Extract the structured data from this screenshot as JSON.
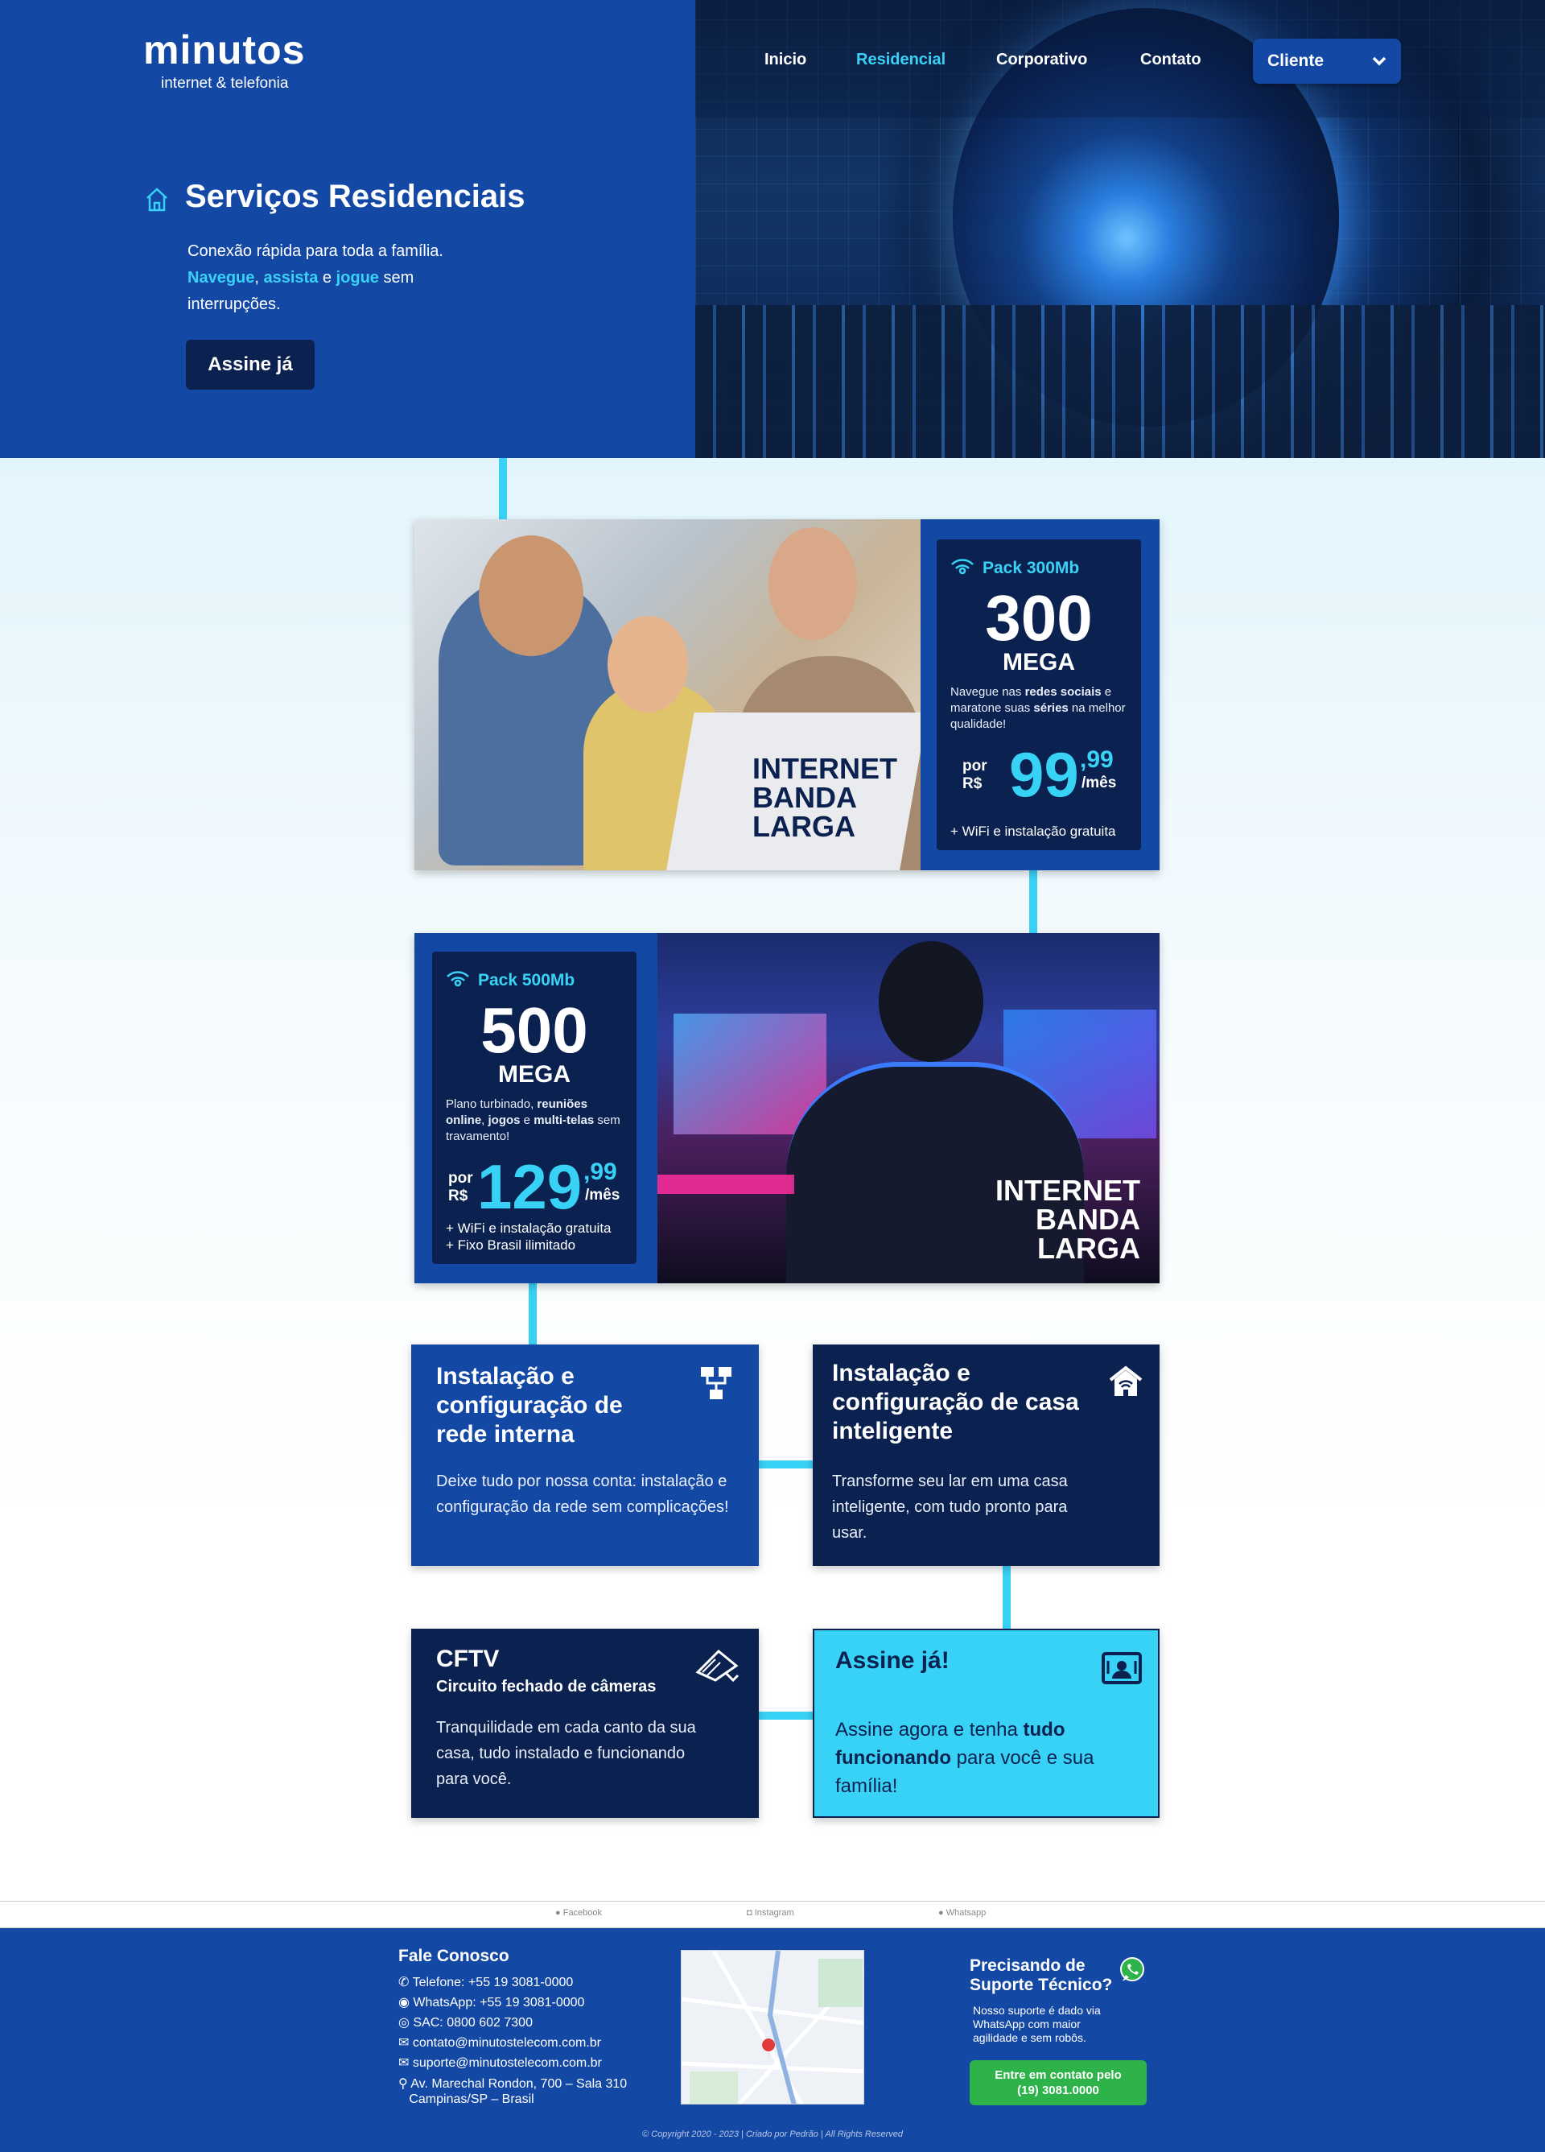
{
  "brand": {
    "name": "minutos",
    "tagline": "internet & telefonia"
  },
  "nav": {
    "items": [
      "Inicio",
      "Residencial",
      "Corporativo",
      "Contato"
    ],
    "active": "Residencial",
    "dropdown_label": "Cliente"
  },
  "hero": {
    "title": "Serviços Residenciais",
    "line1": "Conexão rápida para toda a família.",
    "w_navegue": "Navegue",
    "comma": ",",
    "w_assista": "assista",
    "and": " e ",
    "w_jogue": "jogue",
    "sem": " sem",
    "line3": "interrupções.",
    "cta": "Assine já"
  },
  "packs": [
    {
      "name": "Pack 300Mb",
      "speed": "300",
      "unit": "MEGA",
      "desc_a": "Navegue nas ",
      "desc_b": "redes sociais",
      "desc_c": " e maratone suas ",
      "desc_d": "séries",
      "desc_e": " na melhor qualidade!",
      "por": "por",
      "currency": "R$",
      "price": "99",
      "cents": ",99",
      "period": "/mês",
      "extras": [
        "+ WiFi e instalação gratuita"
      ],
      "overlay": [
        "INTERNET",
        "BANDA",
        "LARGA"
      ]
    },
    {
      "name": "Pack 500Mb",
      "speed": "500",
      "unit": "MEGA",
      "desc_a": "Plano turbinado, ",
      "desc_b": "reuniões online",
      "desc_c": ", ",
      "desc_d": "jogos",
      "desc_e": " e ",
      "desc_f": "multi-telas",
      "desc_g": " sem travamento!",
      "por": "por",
      "currency": "R$",
      "price": "129",
      "cents": ",99",
      "period": "/mês",
      "extras": [
        "+ WiFi e instalação gratuita",
        "+ Fixo Brasil ilimitado"
      ],
      "overlay": [
        "INTERNET",
        "BANDA",
        "LARGA"
      ]
    }
  ],
  "services": [
    {
      "title": "Instalação e configuração de rede interna",
      "text": "Deixe tudo por nossa conta: instalação e configuração da rede sem complicações!",
      "icon": "network-icon"
    },
    {
      "title": "Instalação e configuração de casa inteligente",
      "text": "Transforme seu lar em uma casa inteligente, com tudo pronto para usar.",
      "icon": "smart-home-icon"
    },
    {
      "title": "CFTV",
      "subtitle": "Circuito fechado de câmeras",
      "text": "Tranquilidade em cada canto da sua casa, tudo instalado e funcionando para você.",
      "icon": "camera-icon"
    },
    {
      "title": "Assine já!",
      "text_a": "Assine agora e tenha ",
      "text_b": "tudo funcionando",
      "text_c": " para você e sua família!",
      "icon": "contact-card-icon"
    }
  ],
  "social": [
    "Facebook",
    "Instagram",
    "Whatsapp"
  ],
  "footer": {
    "contact_title": "Fale Conosco",
    "contacts": [
      "Telefone: +55 19 3081-0000",
      "WhatsApp: +55 19 3081-0000",
      "SAC: 0800 602 7300",
      "contato@minutostelecom.com.br",
      "suporte@minutostelecom.com.br",
      "Av. Marechal Rondon, 700 – Sala 310",
      "Campinas/SP – Brasil"
    ],
    "support_title_1": "Precisando de",
    "support_title_2": "Suporte Técnico?",
    "support_text": [
      "Nosso suporte é dado via",
      "WhatsApp com maior",
      "agilidade e sem robôs."
    ],
    "support_button_1": "Entre em contato pelo",
    "support_button_2": "(19) 3081.0000",
    "copyright": "© Copyright 2020 - 2023 | Criado por Pedrão | All Rights Reserved"
  },
  "colors": {
    "primary": "#1448a5",
    "navy": "#0b2150",
    "accent": "#38d2f6",
    "whatsapp": "#2db34a"
  }
}
